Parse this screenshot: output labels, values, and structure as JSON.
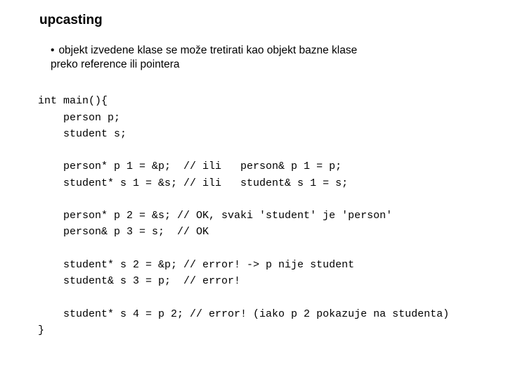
{
  "title": "upcasting",
  "bullet": {
    "dot": "•",
    "line1": "objekt izvedene klase se može tretirati kao objekt bazne klase",
    "line2": "preko reference ili pointera"
  },
  "code": {
    "l01": "int main(){",
    "l02": "    person p;",
    "l03": "    student s;",
    "l04": "",
    "l05": "    person* p 1 = &p;  // ili   person& p 1 = p;",
    "l06": "    student* s 1 = &s; // ili   student& s 1 = s;",
    "l07": "",
    "l08": "    person* p 2 = &s; // OK, svaki 'student' je 'person'",
    "l09": "    person& p 3 = s;  // OK",
    "l10": "",
    "l11": "    student* s 2 = &p; // error! -> p nije student",
    "l12": "    student& s 3 = p;  // error!",
    "l13": "",
    "l14": "    student* s 4 = p 2; // error! (iako p 2 pokazuje na studenta)",
    "l15": "}"
  }
}
